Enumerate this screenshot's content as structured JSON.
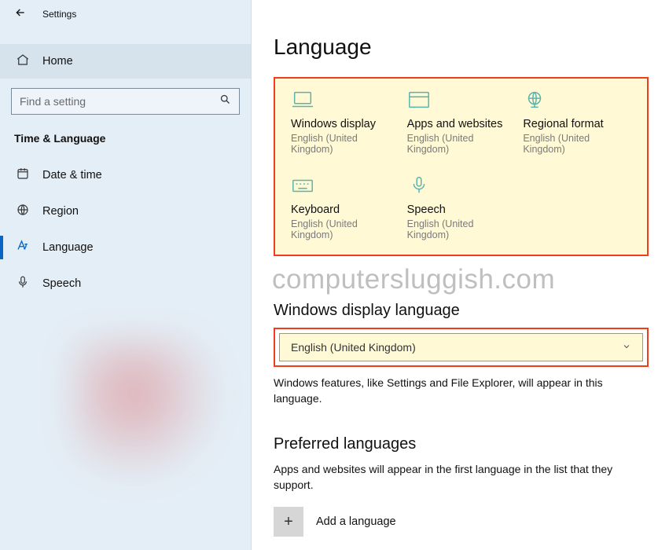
{
  "titlebar": {
    "title": "Settings"
  },
  "sidebar": {
    "home_label": "Home",
    "search_placeholder": "Find a setting",
    "section_label": "Time & Language",
    "items": [
      {
        "label": "Date & time"
      },
      {
        "label": "Region"
      },
      {
        "label": "Language"
      },
      {
        "label": "Speech"
      }
    ]
  },
  "main": {
    "page_title": "Language",
    "tiles": [
      {
        "title": "Windows display",
        "sub": "English (United Kingdom)"
      },
      {
        "title": "Apps and websites",
        "sub": "English (United Kingdom)"
      },
      {
        "title": "Regional format",
        "sub": "English (United Kingdom)"
      },
      {
        "title": "Keyboard",
        "sub": "English (United Kingdom)"
      },
      {
        "title": "Speech",
        "sub": "English (United Kingdom)"
      }
    ],
    "watermark": "computersluggish.com",
    "display_lang_heading": "Windows display language",
    "display_lang_value": "English (United Kingdom)",
    "display_lang_help": "Windows features, like Settings and File Explorer, will appear in this language.",
    "preferred_heading": "Preferred languages",
    "preferred_help": "Apps and websites will appear in the first language in the list that they support.",
    "add_language_label": "Add a language"
  }
}
